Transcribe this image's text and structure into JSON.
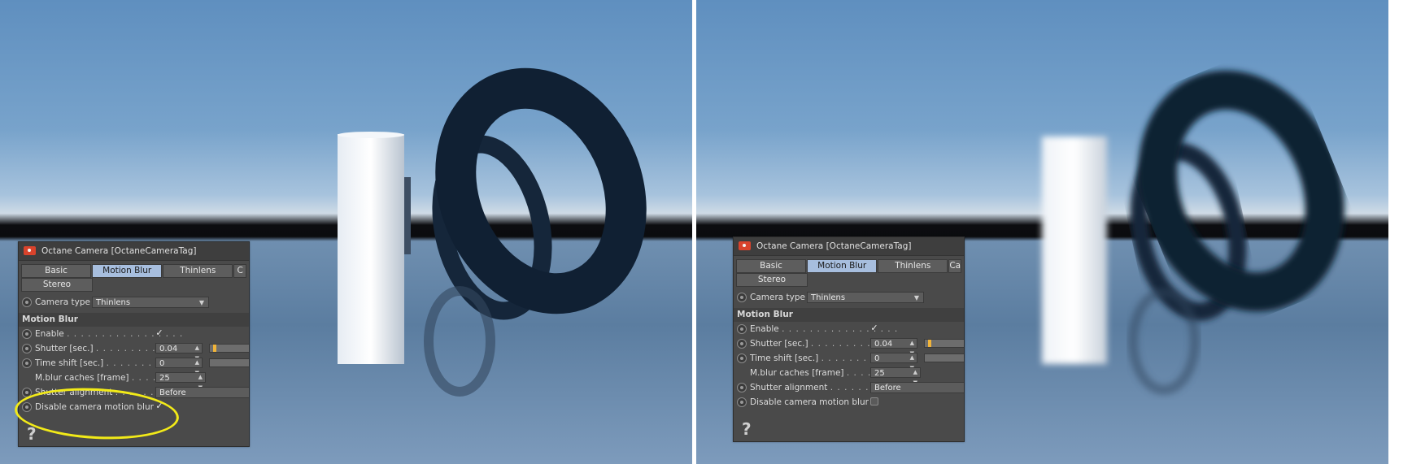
{
  "panels": [
    {
      "title": "Octane Camera [OctaneCameraTag]",
      "tabs": [
        "Basic",
        "Motion Blur",
        "Thinlens",
        "C"
      ],
      "active_tab": "Motion Blur",
      "second_row_tab": "Stereo",
      "camera_type": {
        "label": "Camera type",
        "value": "Thinlens"
      },
      "section_title": "Motion Blur",
      "enable": {
        "label": "Enable",
        "dots": ". . . . . . . . . . . . . . . . .",
        "checked": true
      },
      "shutter": {
        "label": "Shutter [sec.]",
        "dots": ". . . . . . . . . . . . .",
        "value": "0.04"
      },
      "time_shift": {
        "label": "Time shift [sec.]",
        "dots": ". . . . . . . . . .",
        "value": "0"
      },
      "mblur_caches": {
        "label": "M.blur caches [frame]",
        "dots": ". . . . .",
        "value": "25"
      },
      "shutter_alignment": {
        "label": "Shutter alignment",
        "dots": ". . . . . . . .",
        "value": "Before"
      },
      "disable_camera_motion_blur": {
        "label": "Disable camera motion blur",
        "checked": true
      },
      "help": "?"
    },
    {
      "title": "Octane Camera [OctaneCameraTag]",
      "tabs": [
        "Basic",
        "Motion Blur",
        "Thinlens",
        "Camera I"
      ],
      "active_tab": "Motion Blur",
      "second_row_tab": "Stereo",
      "camera_type": {
        "label": "Camera type",
        "value": "Thinlens"
      },
      "section_title": "Motion Blur",
      "enable": {
        "label": "Enable",
        "dots": ". . . . . . . . . . . . . . . . .",
        "checked": true
      },
      "shutter": {
        "label": "Shutter [sec.]",
        "dots": ". . . . . . . . . . . . .",
        "value": "0.04"
      },
      "time_shift": {
        "label": "Time shift [sec.]",
        "dots": ". . . . . . . . . .",
        "value": "0"
      },
      "mblur_caches": {
        "label": "M.blur caches [frame]",
        "dots": ". . . . .",
        "value": "25"
      },
      "shutter_alignment": {
        "label": "Shutter alignment",
        "dots": ". . . . . . . .",
        "value": "Before"
      },
      "disable_camera_motion_blur": {
        "label": "Disable camera motion blur",
        "checked": false
      },
      "help": "?"
    }
  ],
  "check_mark": "✓",
  "highlight_color": "#f2ea18",
  "accent_color": "#f0b43a"
}
